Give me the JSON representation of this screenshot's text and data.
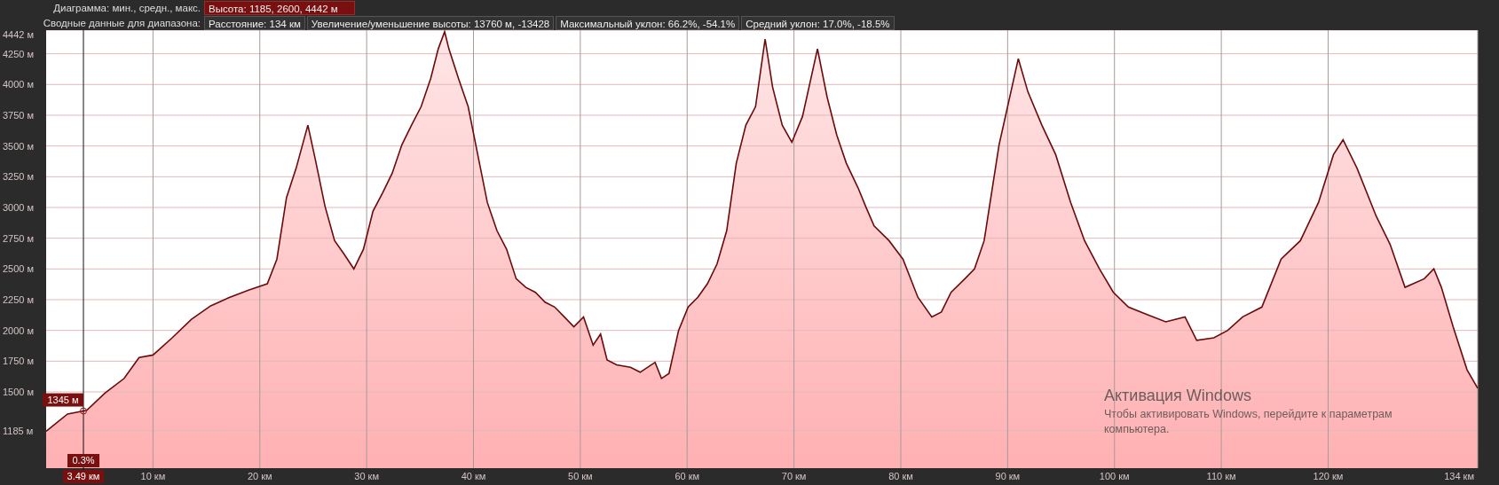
{
  "summary_bar": {
    "chart_row": {
      "label": "Диаграмма: мин., средн., макс.",
      "boxes": [
        {
          "text": "Высота: 1185, 2600, 4442 м",
          "kind": "highlight"
        }
      ]
    },
    "range_row": {
      "label": "Сводные данные для диапазона:",
      "boxes": [
        {
          "text": "Расстояние: 134 км",
          "kind": "plain"
        },
        {
          "text": "Увеличение/уменьшение высоты: 13760 м, -13428",
          "kind": "plain"
        },
        {
          "text": "Максимальный уклон: 66.2%, -54.1%",
          "kind": "plain"
        },
        {
          "text": "Средний уклон: 17.0%, -18.5%",
          "kind": "plain"
        }
      ]
    }
  },
  "chart": {
    "chart_data": {
      "type": "area",
      "x": [
        0,
        2.0,
        3.8,
        5.5,
        7.3,
        8.7,
        10.0,
        11.8,
        13.6,
        15.4,
        17.2,
        19.0,
        20.7,
        21.6,
        22.5,
        23.4,
        24.5,
        25.2,
        26.1,
        27.0,
        27.9,
        28.8,
        29.7,
        30.6,
        31.5,
        32.4,
        33.3,
        34.2,
        35.1,
        36.0,
        36.7,
        37.3,
        37.7,
        38.6,
        39.5,
        40.4,
        41.3,
        42.2,
        43.1,
        44.0,
        44.9,
        45.8,
        46.7,
        47.6,
        48.5,
        49.4,
        50.3,
        51.2,
        51.9,
        52.5,
        53.4,
        54.7,
        55.6,
        57.0,
        57.6,
        58.3,
        59.2,
        60.1,
        61.0,
        61.9,
        62.8,
        63.7,
        64.6,
        65.5,
        66.4,
        67.3,
        68.0,
        68.9,
        69.8,
        70.8,
        72.2,
        73.1,
        74.0,
        74.9,
        76.0,
        76.7,
        77.5,
        78.9,
        80.2,
        81.6,
        82.9,
        83.8,
        84.7,
        86.0,
        86.9,
        87.8,
        89.2,
        91.0,
        91.9,
        93.2,
        94.5,
        95.9,
        97.2,
        98.6,
        99.9,
        101.3,
        103.0,
        104.8,
        106.6,
        107.7,
        109.3,
        110.6,
        112.0,
        113.8,
        115.6,
        117.4,
        119.1,
        120.5,
        121.4,
        122.7,
        124.5,
        125.8,
        127.2,
        129.0,
        129.9,
        130.6,
        131.7,
        133.0,
        134.0
      ],
      "values": [
        1180,
        1320,
        1350,
        1490,
        1610,
        1780,
        1800,
        1940,
        2090,
        2200,
        2270,
        2330,
        2380,
        2580,
        3080,
        3320,
        3670,
        3390,
        3010,
        2730,
        2620,
        2500,
        2660,
        2970,
        3120,
        3280,
        3510,
        3670,
        3820,
        4050,
        4290,
        4430,
        4290,
        4050,
        3820,
        3430,
        3040,
        2810,
        2660,
        2420,
        2350,
        2310,
        2230,
        2190,
        2110,
        2030,
        2110,
        1880,
        1970,
        1760,
        1720,
        1700,
        1660,
        1740,
        1610,
        1650,
        2000,
        2190,
        2270,
        2380,
        2540,
        2810,
        3360,
        3670,
        3820,
        4370,
        3980,
        3670,
        3530,
        3740,
        4290,
        3900,
        3590,
        3360,
        3160,
        3010,
        2850,
        2730,
        2580,
        2270,
        2110,
        2150,
        2310,
        2420,
        2500,
        2730,
        3510,
        4210,
        3940,
        3670,
        3430,
        3040,
        2730,
        2500,
        2310,
        2190,
        2130,
        2070,
        2110,
        1920,
        1940,
        2000,
        2110,
        2190,
        2580,
        2730,
        3040,
        3430,
        3550,
        3320,
        2930,
        2700,
        2350,
        2420,
        2500,
        2350,
        2030,
        1680,
        1530
      ],
      "xlim": [
        0,
        134
      ],
      "ylim": [
        880,
        4442
      ],
      "xticks": [
        {
          "value": 10,
          "label": "10 км"
        },
        {
          "value": 20,
          "label": "20 км"
        },
        {
          "value": 30,
          "label": "30 км"
        },
        {
          "value": 40,
          "label": "40 км"
        },
        {
          "value": 50,
          "label": "50 км"
        },
        {
          "value": 60,
          "label": "60 км"
        },
        {
          "value": 70,
          "label": "70 км"
        },
        {
          "value": 80,
          "label": "80 км"
        },
        {
          "value": 90,
          "label": "90 км"
        },
        {
          "value": 100,
          "label": "100 км"
        },
        {
          "value": 110,
          "label": "110 км"
        },
        {
          "value": 120,
          "label": "120 км"
        },
        {
          "value": 134,
          "label": "134 км"
        }
      ],
      "yticks": [
        {
          "value": 1185,
          "label": "1185 м"
        },
        {
          "value": 1500,
          "label": "1500 м"
        },
        {
          "value": 1750,
          "label": "1750 м"
        },
        {
          "value": 2000,
          "label": "2000 м"
        },
        {
          "value": 2250,
          "label": "2250 м"
        },
        {
          "value": 2500,
          "label": "2500 м"
        },
        {
          "value": 2750,
          "label": "2750 м"
        },
        {
          "value": 3000,
          "label": "3000 м"
        },
        {
          "value": 3250,
          "label": "3250 м"
        },
        {
          "value": 3500,
          "label": "3500 м"
        },
        {
          "value": 3750,
          "label": "3750 м"
        },
        {
          "value": 4000,
          "label": "4000 м"
        },
        {
          "value": 4250,
          "label": "4250 м"
        },
        {
          "value": 4442,
          "label": "4442 м"
        }
      ],
      "grid": true,
      "ref_lines": [
        {
          "axis": "x",
          "value": 3.49,
          "label": "3.49 км"
        }
      ]
    },
    "cursor": {
      "elevation": "1345 м",
      "slope": "0.3%"
    }
  },
  "windows_activation_notice": {
    "title": "Активация Windows",
    "text": "Чтобы активировать Windows, перейдите к параметрам компьютера."
  }
}
